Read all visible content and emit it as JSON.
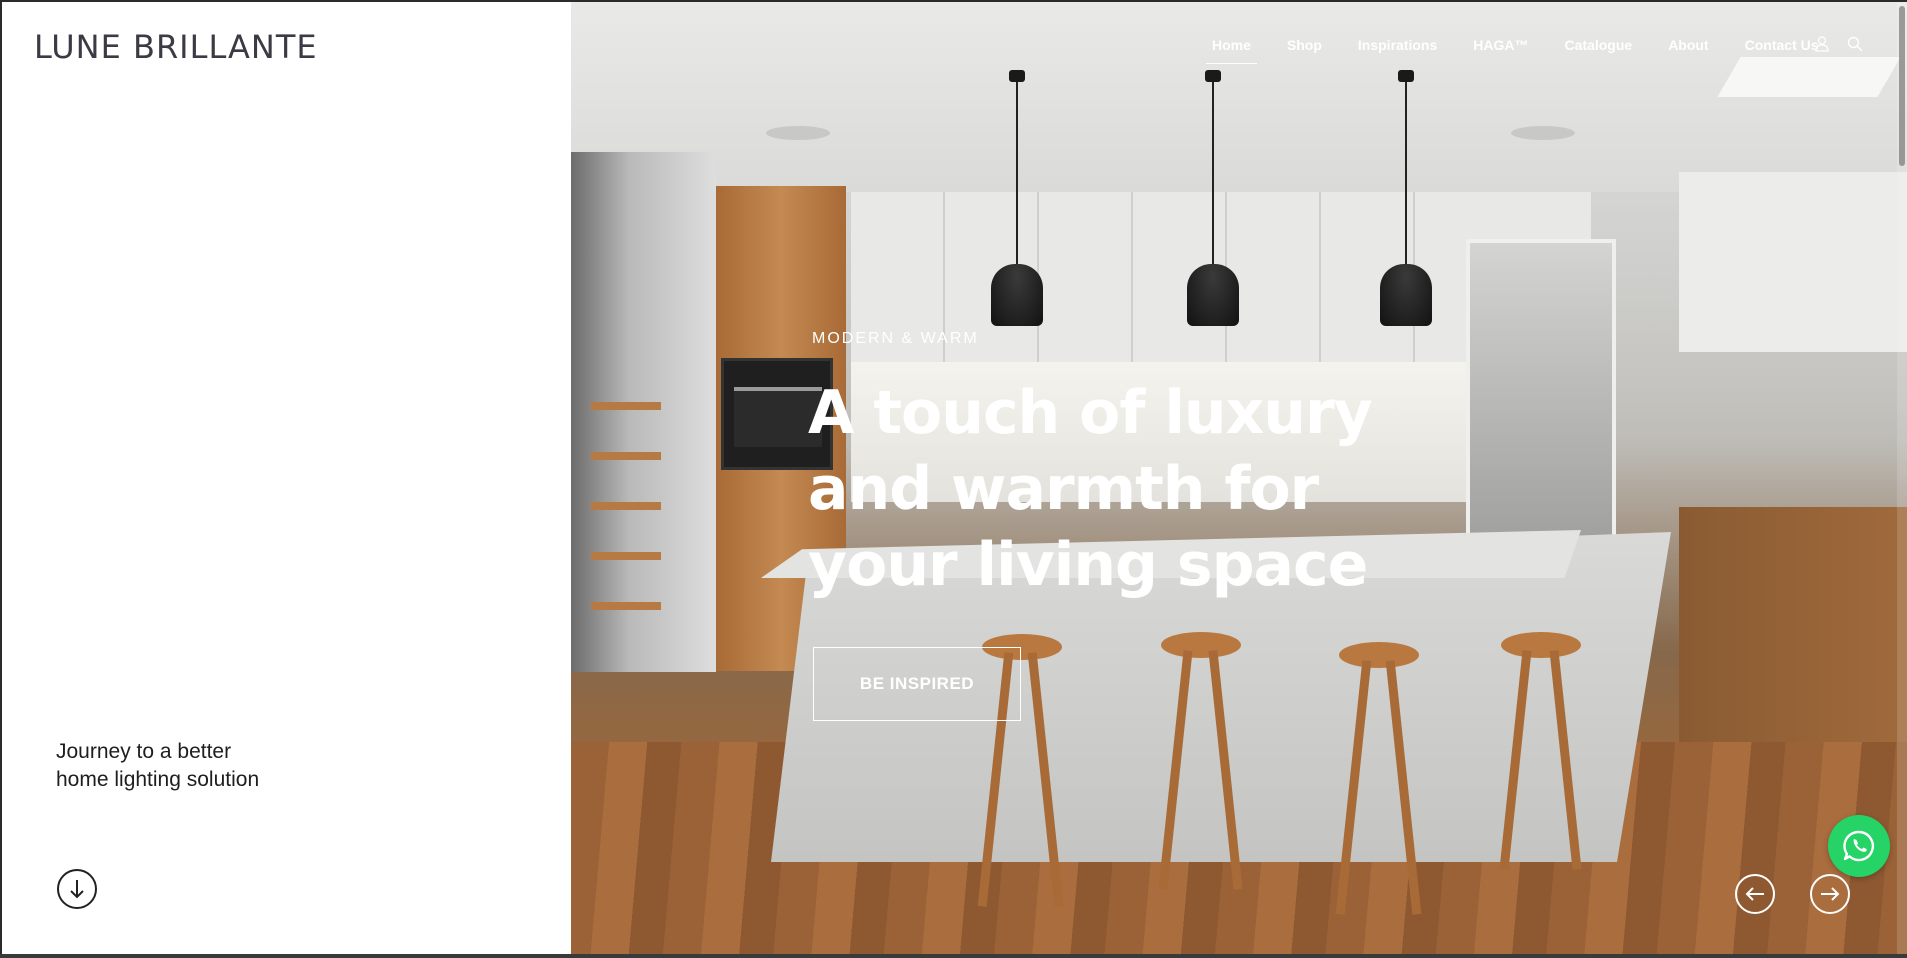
{
  "brand": {
    "logo": "LUNE BRILLANTE"
  },
  "nav": {
    "items": [
      "Home",
      "Shop",
      "Inspirations",
      "HAGA™",
      "Catalogue",
      "About",
      "Contact Us"
    ],
    "active": "Home",
    "icons": [
      "user-icon",
      "search-icon"
    ]
  },
  "hero": {
    "eyebrow": "MODERN & WARM",
    "headline": "A touch of luxury and warmth for your living space",
    "cta_label": "BE INSPIRED"
  },
  "left_panel": {
    "tagline": "Journey to a better home lighting solution"
  },
  "slider": {
    "prev_icon": "arrow-left-icon",
    "next_icon": "arrow-right-icon"
  },
  "colors": {
    "accent_whatsapp": "#25d366",
    "logo_text": "#3b3a45",
    "hero_text": "#ffffff"
  }
}
